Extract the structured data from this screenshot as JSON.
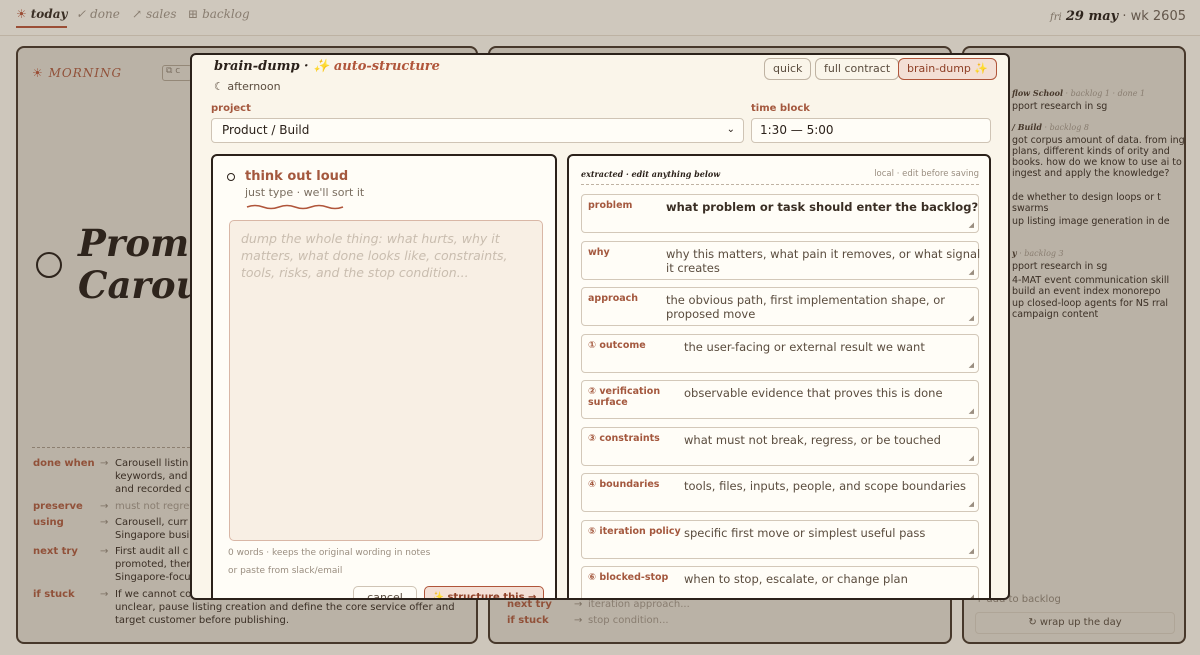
{
  "nav": {
    "tabs": [
      {
        "icon": "☀",
        "label": "today"
      },
      {
        "icon": "✓",
        "label": "done"
      },
      {
        "icon": "↗",
        "label": "sales"
      },
      {
        "icon": "⊞",
        "label": "backlog"
      }
    ],
    "date_day": "fri",
    "date_main": "29 may",
    "date_week": "· wk 2605"
  },
  "left_panel": {
    "section": "MORNING",
    "copy_chip": "⧉ c",
    "title_line1": "Promot",
    "title_line2": "Carous",
    "rows": [
      {
        "key": "done when",
        "value_lines": [
          "Carousell listin",
          "keywords, and",
          "and recorded c"
        ]
      },
      {
        "key": "preserve",
        "value_lines": [
          "must not regre"
        ]
      },
      {
        "key": "using",
        "value_lines": [
          "Carousell, curr",
          "Singapore busi"
        ]
      },
      {
        "key": "next try",
        "value_lines": [
          "First audit all c",
          "promoted, ther",
          "Singapore-focu"
        ]
      },
      {
        "key": "if stuck",
        "value_lines": [
          "If we cannot co",
          "unclear, pause listing creation and define the core service offer and",
          "target customer before publishing."
        ]
      }
    ]
  },
  "middle_panel": {
    "rows": [
      {
        "key": "next try",
        "value": "iteration approach..."
      },
      {
        "key": "if stuck",
        "value": "stop condition..."
      }
    ]
  },
  "right_panel": {
    "sections": [
      {
        "title": "flow School",
        "meta": "· backlog 1 · done 1",
        "items": [
          "pport research in sg"
        ]
      },
      {
        "title": "/ Build",
        "meta": "· backlog 8",
        "items": [
          "got corpus amount of data. from ing plans, different kinds of ority and books. how do we know to use ai to ingest and apply the knowledge?",
          "de whether to design loops or t swarms",
          "up listing image generation in de"
        ]
      },
      {
        "title": "y",
        "meta": "· backlog 3",
        "items": [
          "pport research in sg",
          "4-MAT event communication skill build an event index monorepo",
          "up closed-loop agents for NS rral campaign content"
        ]
      }
    ],
    "add_backlog": "+ add to backlog",
    "wrap_up": "↻ wrap up the day"
  },
  "modal": {
    "title": "brain-dump ·",
    "sparkle": "✨",
    "title_accent": "auto-structure",
    "subtitle_icon": "☾",
    "subtitle": "afternoon",
    "modes": [
      "quick",
      "full contract",
      "brain-dump ✨"
    ],
    "project_label": "project",
    "project_value": "Product / Build",
    "time_label": "time block",
    "time_value": "1:30 — 5:00",
    "think": {
      "title": "think out loud",
      "subtitle": "just type · we'll sort it",
      "placeholder": "dump the whole thing: what hurts, why it matters, what done looks like, constraints, tools, risks, and the stop condition...",
      "word_count": "0 words · keeps the original wording in notes",
      "paste_hint": "or paste from slack/email",
      "cancel": "cancel",
      "structure": "✨ structure this →"
    },
    "extracted": {
      "heading": "extracted · edit anything below",
      "note": "local · edit before saving",
      "fields": [
        {
          "key": "problem",
          "value": "what problem or task should enter the backlog?",
          "bold": true
        },
        {
          "key": "why",
          "value": "why this matters, what pain it removes, or what signal it creates"
        },
        {
          "key": "approach",
          "value": "the obvious path, first implementation shape, or proposed move"
        },
        {
          "key": "① outcome",
          "value": "the user-facing or external result we want"
        },
        {
          "key": "② verification surface",
          "value": "observable evidence that proves this is done"
        },
        {
          "key": "③ constraints",
          "value": "what must not break, regress, or be touched"
        },
        {
          "key": "④ boundaries",
          "value": "tools, files, inputs, people, and scope boundaries"
        },
        {
          "key": "⑤ iteration policy",
          "value": "specific first move or simplest useful pass"
        },
        {
          "key": "⑥ blocked-stop",
          "value": "when to stop, escalate, or change plan"
        }
      ]
    }
  }
}
